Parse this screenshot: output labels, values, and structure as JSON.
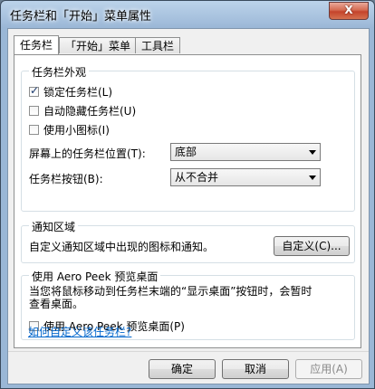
{
  "window": {
    "title": "任务栏和「开始」菜单属性",
    "close_label": "X"
  },
  "tabs": [
    {
      "label": "任务栏"
    },
    {
      "label": "「开始」菜单"
    },
    {
      "label": "工具栏"
    }
  ],
  "appearance": {
    "title": "任务栏外观",
    "lock_label": "锁定任务栏(L)",
    "lock_checked": true,
    "autohide_label": "自动隐藏任务栏(U)",
    "autohide_checked": false,
    "small_icons_label": "使用小图标(I)",
    "small_icons_checked": false,
    "location_label": "屏幕上的任务栏位置(T):",
    "location_value": "底部",
    "buttons_label": "任务栏按钮(B):",
    "buttons_value": "从不合并"
  },
  "notification": {
    "title": "通知区域",
    "description": "自定义通知区域中出现的图标和通知。",
    "customize_label": "自定义(C)..."
  },
  "aero_peek": {
    "title": "使用 Aero Peek 预览桌面",
    "description_line1": "当您将鼠标移动到任务栏末端的“显示桌面”按钮时，会暂时",
    "description_line2": "查看桌面。",
    "checkbox_label": "使用 Aero Peek 预览桌面(P)",
    "checkbox_checked": false
  },
  "help_link": "如何自定义该任务栏?",
  "footer": {
    "ok_label": "确定",
    "cancel_label": "取消",
    "apply_label": "应用(A)"
  },
  "colors": {
    "link": "#0066cc",
    "close": "#c4432b"
  }
}
